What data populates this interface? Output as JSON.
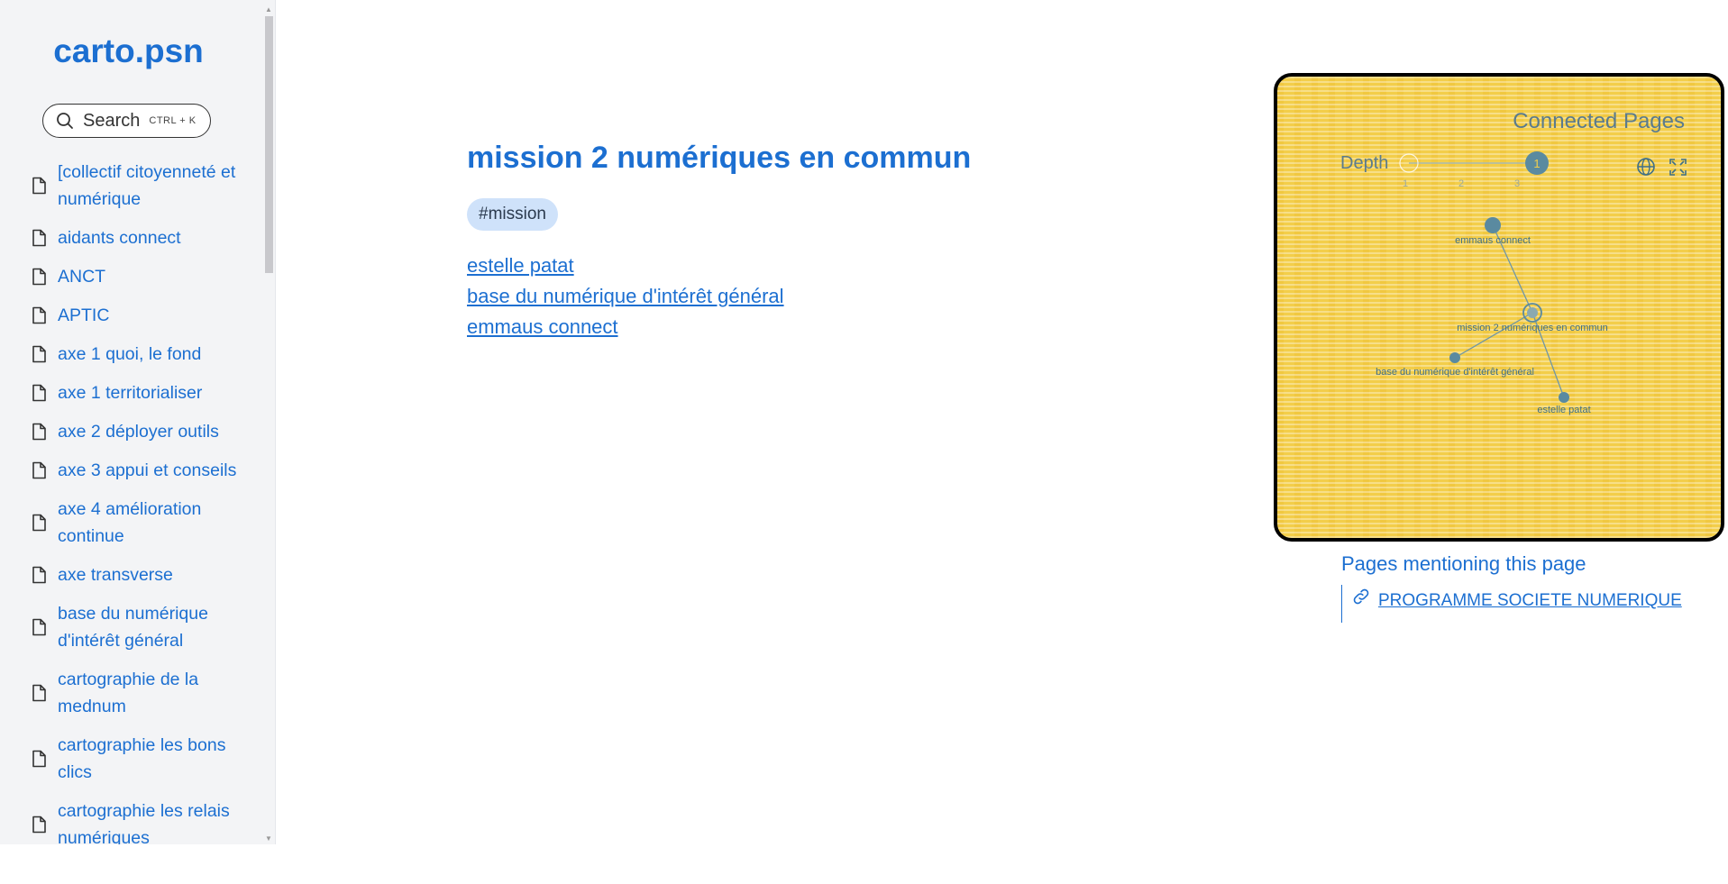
{
  "app": {
    "brand": "carto.psn"
  },
  "search": {
    "label": "Search",
    "shortcut": "CTRL + K"
  },
  "sidebar": {
    "items": [
      {
        "label": "[collectif citoyenneté et numérique"
      },
      {
        "label": "aidants connect"
      },
      {
        "label": "ANCT"
      },
      {
        "label": "APTIC"
      },
      {
        "label": "axe 1 quoi, le fond"
      },
      {
        "label": "axe 1 territorialiser"
      },
      {
        "label": "axe 2 déployer outils"
      },
      {
        "label": "axe 3 appui et conseils"
      },
      {
        "label": "axe 4 amélioration continue"
      },
      {
        "label": "axe transverse"
      },
      {
        "label": "base du numérique d'intérêt général"
      },
      {
        "label": "cartographie de la mednum"
      },
      {
        "label": "cartographie les bons clics"
      },
      {
        "label": "cartographie les relais numériques"
      }
    ]
  },
  "page": {
    "title": "mission 2 numériques en commun",
    "tag": "#mission",
    "links": [
      {
        "label": "estelle patat"
      },
      {
        "label": "base du numérique d'intérêt général"
      },
      {
        "label": "emmaus connect"
      }
    ]
  },
  "graph": {
    "title": "Connected Pages",
    "depth_label": "Depth",
    "depth_ticks": [
      "1",
      "2",
      "3"
    ],
    "depth_value": "1",
    "colors": {
      "background": "#f3ce4a",
      "node": "#5a8aa0",
      "line": "#6f96a6"
    },
    "nodes": [
      {
        "label": "emmaus connect"
      },
      {
        "label": "mission 2 numériques en commun"
      },
      {
        "label": "base du numérique d'intérêt général"
      },
      {
        "label": "estelle patat"
      }
    ]
  },
  "backlinks": {
    "title": "Pages mentioning this page",
    "items": [
      {
        "label": "PROGRAMME SOCIETE NUMERIQUE"
      }
    ]
  }
}
